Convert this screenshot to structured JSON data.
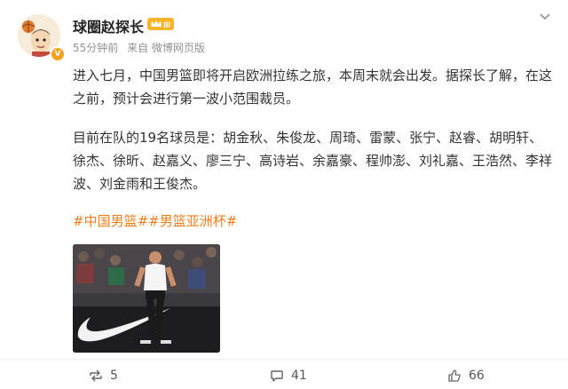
{
  "post": {
    "author": "球圈赵探长",
    "level_badge": "III",
    "time": "55分钟前",
    "source": "来自 微博网页版",
    "paragraph1": "进入七月，中国男篮即将开启欧洲拉练之旅，本周末就会出发。据探长了解，在这之前，预计会进行第一波小范围裁员。",
    "paragraph2": "目前在队的19名球员是：胡金秋、朱俊龙、周琦、雷蒙、张宁、赵睿、胡明轩、徐杰、徐昕、赵嘉义、廖三宁、高诗岩、余嘉豪、程帅澎、刘礼嘉、王浩然、李祥波、刘金雨和王俊杰。",
    "hashtag1": "#中国男篮#",
    "hashtag2": "#男篮亚洲杯#"
  },
  "actions": {
    "repost_count": "5",
    "comment_count": "41",
    "like_count": "66"
  },
  "colors": {
    "hashtag": "#f27f1b",
    "meta_text": "#939393",
    "verified_badge": "#f7a21b"
  },
  "icons": [
    "avatar",
    "verified-icon",
    "level-crown-icon",
    "more-chevron-icon",
    "repost-icon",
    "comment-icon",
    "like-icon"
  ]
}
